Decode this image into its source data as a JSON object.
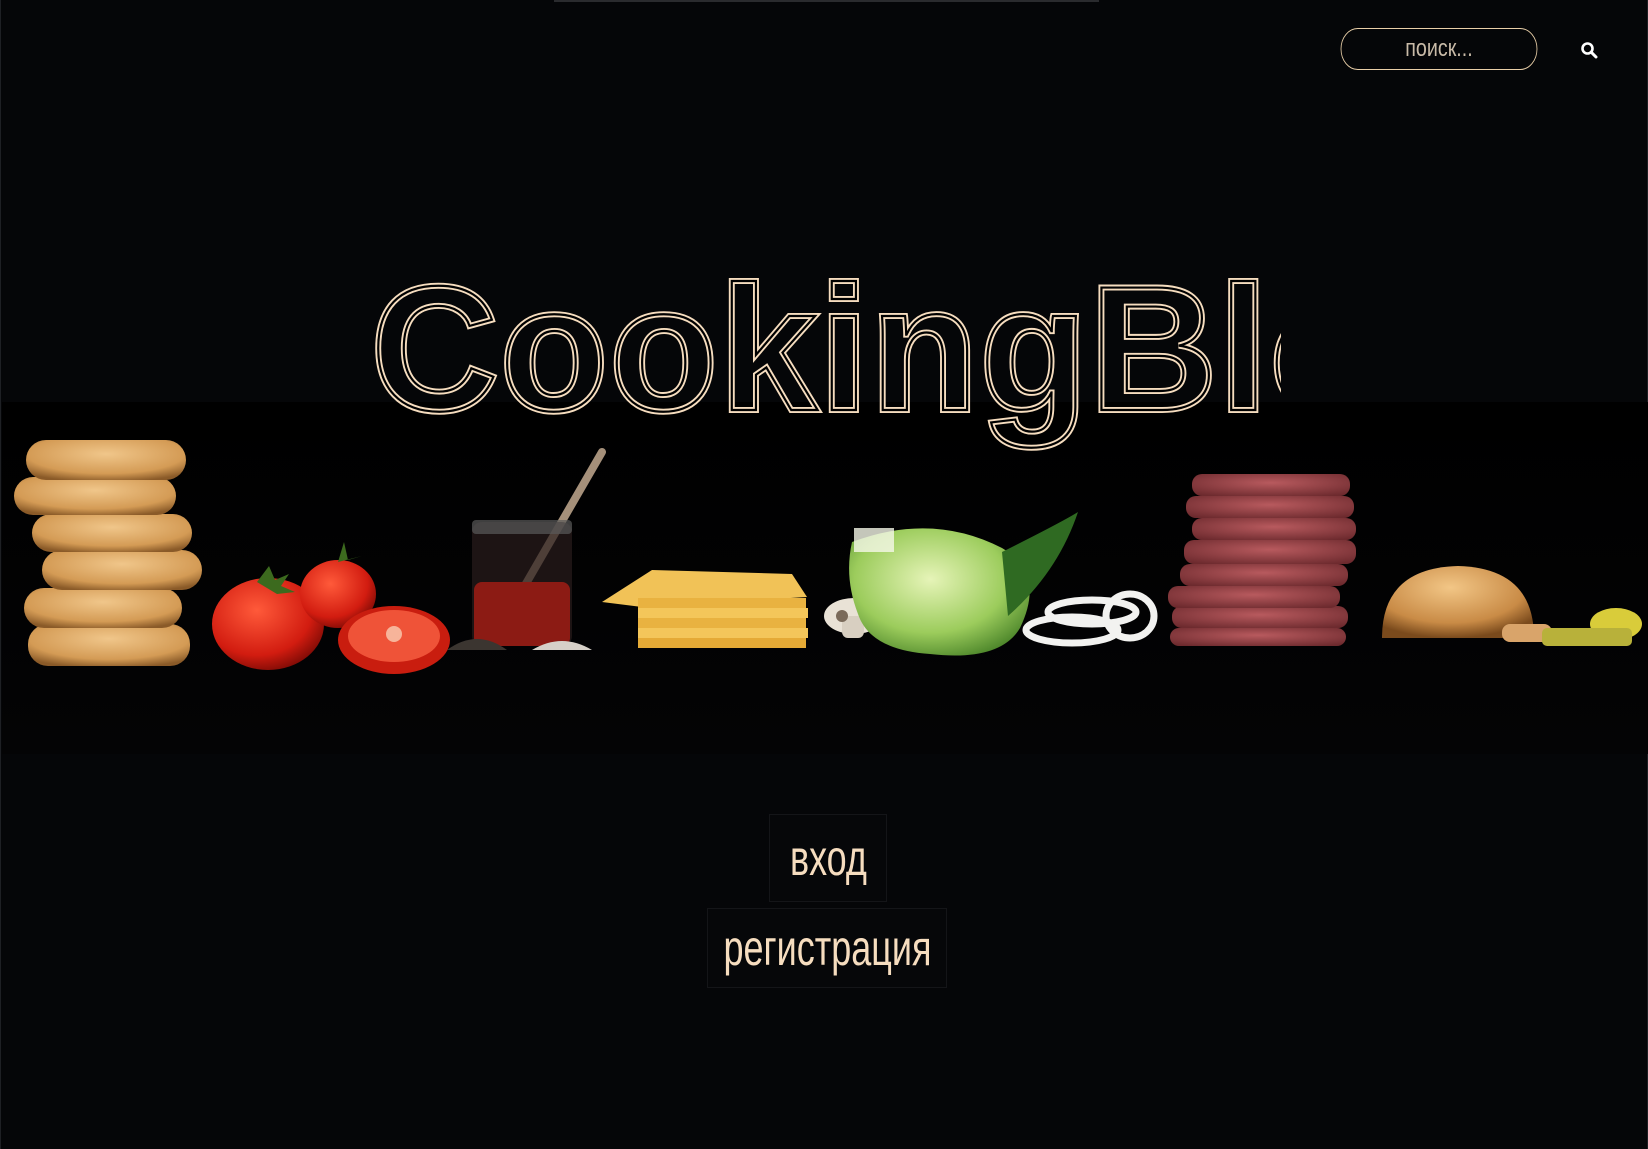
{
  "header": {
    "search": {
      "placeholder": "поиск...",
      "button_icon": "search-icon"
    }
  },
  "hero": {
    "title": "CookingBlog",
    "image_description_icons": [
      "burger-buns",
      "tomatoes",
      "ketchup-jar",
      "cheese-slices",
      "mushroom",
      "lettuce",
      "onion-rings",
      "beef-patties",
      "burger",
      "pickles"
    ]
  },
  "auth": {
    "login_label": "вход",
    "register_label": "регистрация"
  },
  "colors": {
    "background": "#050608",
    "accent": "#f6ddbf",
    "search_border": "#e9cfa8"
  }
}
